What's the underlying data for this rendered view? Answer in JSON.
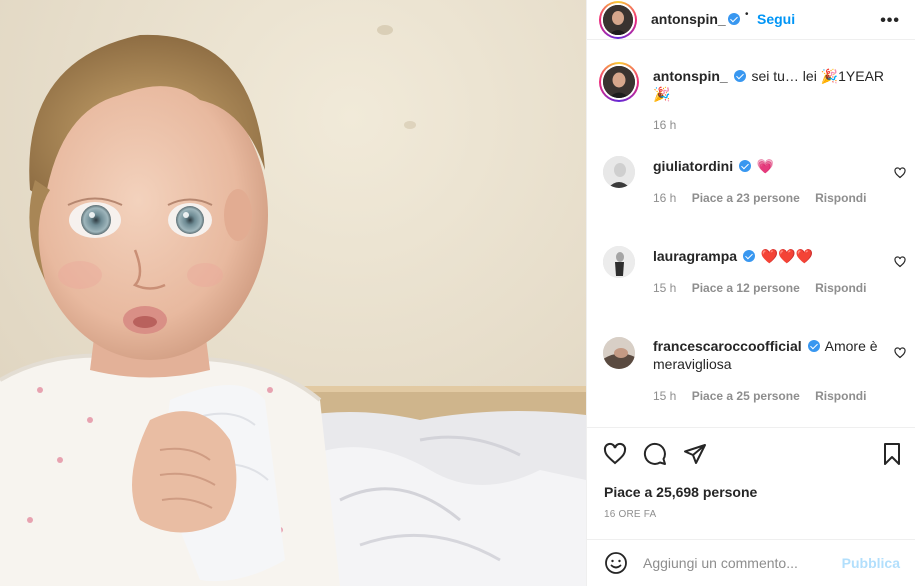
{
  "post": {
    "author": "antonspin_",
    "follow_label": "Segui",
    "separator": "•",
    "more_label": "•••",
    "caption": {
      "text": "sei tu… lei 🎉1YEAR 🎉",
      "time": "16 h"
    }
  },
  "comments": [
    {
      "user": "giuliatordini",
      "text": "💗",
      "time": "16 h",
      "likes": "Piace a 23 persone",
      "reply": "Rispondi"
    },
    {
      "user": "lauragrampa",
      "text": "❤️❤️❤️",
      "time": "15 h",
      "likes": "Piace a 12 persone",
      "reply": "Rispondi"
    },
    {
      "user": "francescaroccoofficial",
      "text": "Amore è meravigliosa",
      "time": "15 h",
      "likes": "Piace a 25 persone",
      "reply": "Rispondi"
    }
  ],
  "footer": {
    "likes": "Piace a 25,698 persone",
    "age": "16 ORE FA",
    "comment_placeholder": "Aggiungi un commento...",
    "publish_label": "Pubblica"
  },
  "icons": {
    "like": "heart-icon",
    "comment": "comment-icon",
    "share": "paper-plane-icon",
    "save": "bookmark-icon",
    "emoji": "smiley-icon",
    "verified": "verified-badge-icon",
    "options": "more-icon"
  },
  "colors": {
    "link_blue": "#0095f6",
    "verified_blue": "#3897f0",
    "muted": "#8e8e8e",
    "publish_disabled": "#b2dffc"
  }
}
